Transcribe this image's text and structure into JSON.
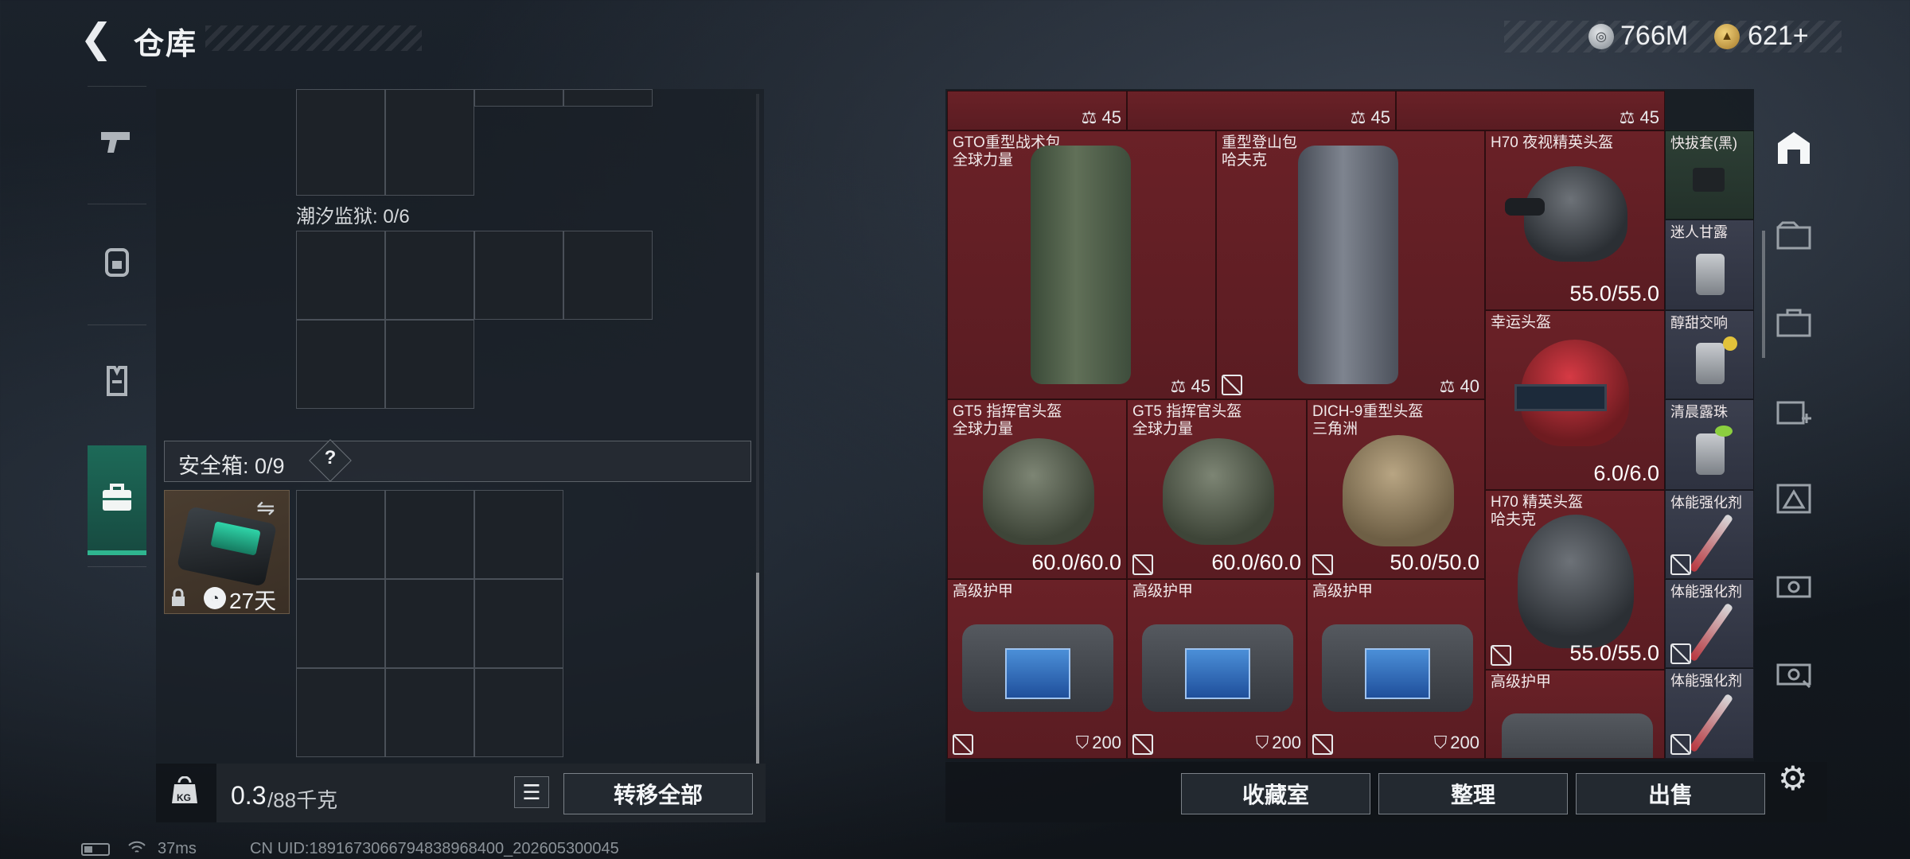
{
  "header": {
    "back_icon": "back-arrow-icon",
    "title": "仓库"
  },
  "currency": [
    {
      "icon": "silver-coin-icon",
      "value": "766M"
    },
    {
      "icon": "gold-coin-icon",
      "value": "621+"
    }
  ],
  "rail": {
    "items": [
      {
        "icon": "pistol-icon",
        "label": "weapons"
      },
      {
        "icon": "backpack-icon",
        "label": "backpack"
      },
      {
        "icon": "vest-icon",
        "label": "vest"
      },
      {
        "icon": "briefcase-icon",
        "label": "safe-box",
        "active": true
      }
    ]
  },
  "storage": {
    "grid_label": "潮汐监狱: 0/6",
    "safe_box_label": "安全箱: 0/9",
    "help_symbol": "?",
    "safe_box_days": "27天"
  },
  "footer": {
    "kg_label": "KG",
    "weight_value": "0.3",
    "weight_capacity": "/88千克",
    "transfer_all": "转移全部"
  },
  "inventory": {
    "top_row_values": [
      "45",
      "45",
      "45"
    ],
    "items": [
      {
        "name": "GTO重型战术包\n全球力量",
        "value": "45"
      },
      {
        "name": "重型登山包\n哈夫克",
        "value": "40"
      },
      {
        "name": "H70 夜视精英头盔",
        "value": "55.0/55.0"
      },
      {
        "name": "快拔套(黑)"
      },
      {
        "name": "迷人甘露"
      },
      {
        "name": "幸运头盔",
        "value": "6.0/6.0"
      },
      {
        "name": "醇甜交响"
      },
      {
        "name": "GT5 指挥官头盔\n全球力量",
        "value": "60.0/60.0"
      },
      {
        "name": "GT5 指挥官头盔\n全球力量",
        "value": "60.0/60.0"
      },
      {
        "name": "DICH-9重型头盔\n三角洲",
        "value": "50.0/50.0"
      },
      {
        "name": "清晨露珠"
      },
      {
        "name": "H70 精英头盔\n哈夫克",
        "value": "55.0/55.0"
      },
      {
        "name": "体能强化剂"
      },
      {
        "name": "高级护甲",
        "value": "200"
      },
      {
        "name": "高级护甲",
        "value": "200"
      },
      {
        "name": "高级护甲",
        "value": "200"
      },
      {
        "name": "体能强化剂"
      },
      {
        "name": "高级护甲"
      },
      {
        "name": "体能强化剂"
      }
    ]
  },
  "right_tabs": [
    "storage-room-icon",
    "tab-IV-icon",
    "tab-III-icon",
    "tab-II-icon",
    "tab-IV-alt-icon",
    "tab-V-icon",
    "tab-V-alt-icon"
  ],
  "bottom_buttons": {
    "collection": "收藏室",
    "organize": "整理",
    "sell": "出售"
  },
  "status_bar": {
    "ping": "37ms",
    "uid": "CN UID:1891673066794838968400_202605300045"
  },
  "colors": {
    "accent_green": "#2fb58f",
    "item_red": "#6a2127",
    "item_green": "#2d3f35",
    "item_slate": "#3b3f4e"
  }
}
